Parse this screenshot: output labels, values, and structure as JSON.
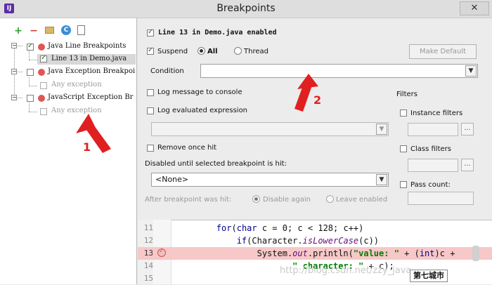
{
  "window": {
    "title": "Breakpoints",
    "app_icon": "IJ",
    "close": "✕"
  },
  "toolbar": {
    "add": "+",
    "remove": "−",
    "group_icon": "folder-icon",
    "c_icon": "C",
    "doc_icon": "document-icon"
  },
  "tree": {
    "items": [
      {
        "label": "Java Line Breakpoints",
        "checked": true
      },
      {
        "label": "Line 13 in Demo.java",
        "checked": true
      },
      {
        "label": "Java Exception Breakpoi",
        "checked": false
      },
      {
        "label": "Any exception",
        "checked": false
      },
      {
        "label": "JavaScript Exception Br",
        "checked": false
      },
      {
        "label": "Any exception",
        "checked": false
      }
    ]
  },
  "details": {
    "header": "Line 13 in Demo.java enabled",
    "suspend_label": "Suspend",
    "all_label": "All",
    "thread_label": "Thread",
    "make_default_label": "Make Default",
    "condition_label": "Condition",
    "log_message_label": "Log message to console",
    "log_expression_label": "Log evaluated expression",
    "remove_once_label": "Remove once hit",
    "disabled_until_label": "Disabled until selected breakpoint is hit:",
    "disabled_until_value": "<None>",
    "after_hit_label": "After breakpoint was hit:",
    "disable_again_label": "Disable again",
    "leave_enabled_label": "Leave enabled"
  },
  "filters": {
    "title": "Filters",
    "instance_label": "Instance filters",
    "class_label": "Class filters",
    "pass_count_label": "Pass count:",
    "more_button": "..."
  },
  "editor": {
    "lines": [
      {
        "num": "11",
        "parts": [
          {
            "t": "        "
          },
          {
            "t": "for",
            "c": "kw"
          },
          {
            "t": "("
          },
          {
            "t": "char",
            "c": "kw"
          },
          {
            "t": " c = "
          },
          {
            "t": "0",
            "c": "num"
          },
          {
            "t": "; c < "
          },
          {
            "t": "128",
            "c": "num"
          },
          {
            "t": "; c++)"
          }
        ]
      },
      {
        "num": "12",
        "parts": [
          {
            "t": "            "
          },
          {
            "t": "if",
            "c": "kw"
          },
          {
            "t": "(Character."
          },
          {
            "t": "isLowerCase",
            "c": "ital"
          },
          {
            "t": "(c))"
          }
        ]
      },
      {
        "num": "13",
        "parts": [
          {
            "t": "                System."
          },
          {
            "t": "out",
            "c": "ital"
          },
          {
            "t": ".println("
          },
          {
            "t": "\"value: \"",
            "c": "str"
          },
          {
            "t": " + ("
          },
          {
            "t": "int",
            "c": "kw"
          },
          {
            "t": ")c +"
          }
        ]
      },
      {
        "num": "14",
        "parts": [
          {
            "t": "                       "
          },
          {
            "t": "\" character: \"",
            "c": "str"
          },
          {
            "t": " + c);"
          }
        ]
      },
      {
        "num": "15",
        "parts": [
          {
            "t": ""
          }
        ]
      }
    ]
  },
  "annotations": {
    "arrow1": "1",
    "arrow2": "2",
    "watermark": "http://blog.csdn.net/zzy_java",
    "logo": "第七城市"
  }
}
